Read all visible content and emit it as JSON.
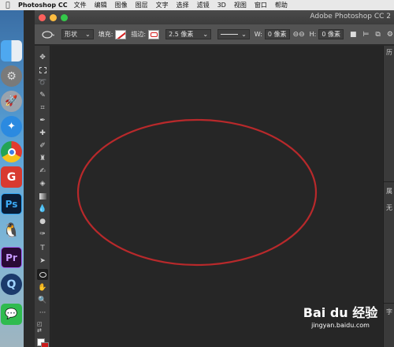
{
  "menubar": {
    "apple": "",
    "app_name": "Photoshop CC",
    "items": [
      "文件",
      "编辑",
      "图像",
      "图层",
      "文字",
      "选择",
      "滤镜",
      "3D",
      "视图",
      "窗口",
      "帮助"
    ]
  },
  "window": {
    "title": "Adobe Photoshop CC 2"
  },
  "options_bar": {
    "mode": "形状",
    "fill_label": "填充:",
    "stroke_label": "描边:",
    "stroke_width": "2.5 像素",
    "w_label": "W:",
    "w_value": "0 像素",
    "h_label": "H:",
    "h_value": "0 像素"
  },
  "right_panel": {
    "history_label": "历",
    "properties_label": "属",
    "properties_value": "无",
    "char_label": "字"
  },
  "canvas": {
    "shape": "ellipse",
    "stroke_color": "#b8292b"
  },
  "watermark": {
    "logo": "Bai du 经验",
    "url": "jingyan.baidu.com"
  },
  "dock": {
    "icons": [
      "finder-icon",
      "system-preferences-icon",
      "launchpad-icon",
      "safari-icon",
      "chrome-icon",
      "app-g-icon",
      "photoshop-icon",
      "qq-icon",
      "premiere-icon",
      "quicktime-icon",
      "wechat-icon"
    ]
  }
}
